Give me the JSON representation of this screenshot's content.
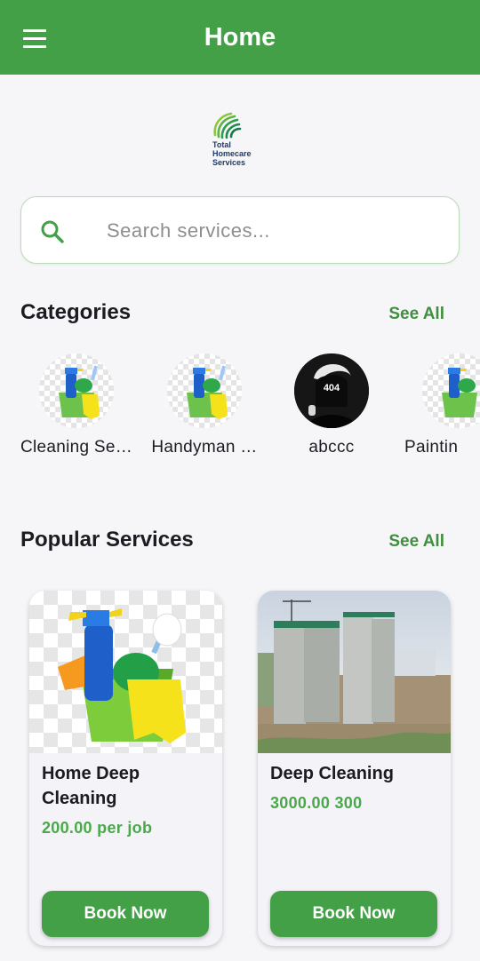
{
  "appbar": {
    "title": "Home",
    "menu_icon": "hamburger-menu-icon"
  },
  "logo": {
    "line1": "Total",
    "line2": "Homecare",
    "line3": "Services"
  },
  "search": {
    "placeholder": "Search services...",
    "value": "",
    "icon": "search-icon"
  },
  "categories": {
    "title": "Categories",
    "see_all": "See All",
    "items": [
      {
        "label": "Cleaning Se…",
        "icon": "cleaning-supplies-icon"
      },
      {
        "label": "Handyman …",
        "icon": "cleaning-supplies-icon"
      },
      {
        "label": "abccc",
        "icon": "404-avatar-icon"
      },
      {
        "label": "Paintin",
        "icon": "cleaning-supplies-icon"
      }
    ]
  },
  "popular": {
    "title": "Popular Services",
    "see_all": "See All",
    "cards": [
      {
        "title": "Home Deep Cleaning",
        "price": "200.00 per job",
        "button": "Book Now",
        "image": "cleaning-supplies-image"
      },
      {
        "title": "Deep Cleaning",
        "price": "3000.00 300",
        "button": "Book Now",
        "image": "building-construction-photo"
      }
    ]
  },
  "colors": {
    "primary": "#43a047",
    "price": "#4aa84a",
    "background": "#f6f6f8"
  }
}
